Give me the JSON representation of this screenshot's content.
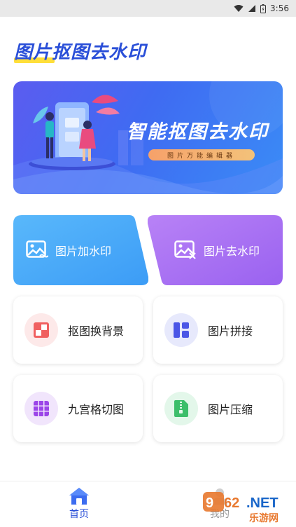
{
  "status_bar": {
    "time": "3:56"
  },
  "app": {
    "title": "图片抠图去水印"
  },
  "banner": {
    "headline": "智能抠图去水印",
    "subtitle": "图片万能编辑器"
  },
  "actions": {
    "add_watermark": "图片加水印",
    "remove_watermark": "图片去水印"
  },
  "tools": [
    {
      "label": "抠图换背景",
      "icon": "cutout-icon",
      "color": "#f06060",
      "bg": "#fde9e9"
    },
    {
      "label": "图片拼接",
      "icon": "collage-icon",
      "color": "#4b56e6",
      "bg": "#e7e9fc"
    },
    {
      "label": "九宫格切图",
      "icon": "grid-icon",
      "color": "#9b45e8",
      "bg": "#f1e5fc"
    },
    {
      "label": "图片压缩",
      "icon": "zip-icon",
      "color": "#3cbe6a",
      "bg": "#e3f7ea"
    }
  ],
  "nav": {
    "home": "首页",
    "mine": "我的"
  },
  "colors": {
    "accent": "#2a4fd8",
    "highlight": "#ffdf3a"
  },
  "watermark": {
    "text": "962.NET",
    "sub": "乐游网"
  }
}
